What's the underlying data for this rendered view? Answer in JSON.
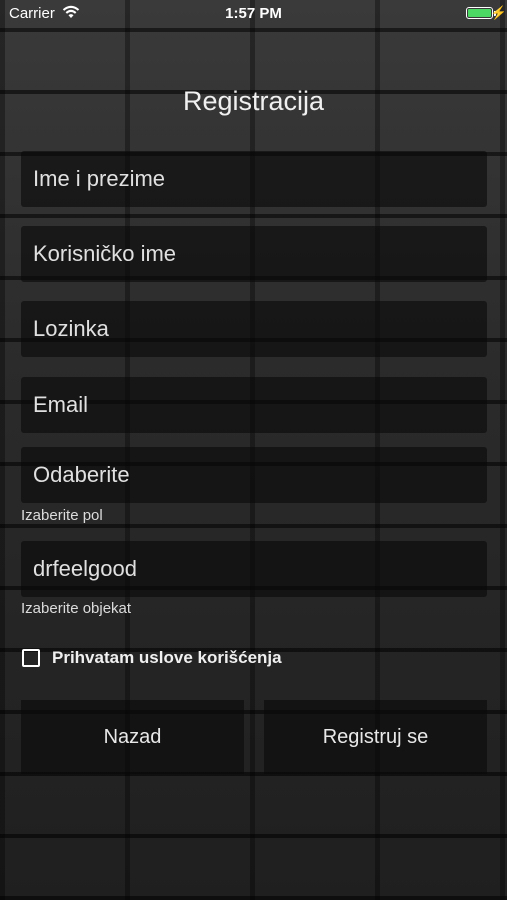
{
  "status_bar": {
    "carrier": "Carrier",
    "time": "1:57 PM",
    "battery_color": "#4cd964"
  },
  "screen": {
    "title": "Registracija"
  },
  "form": {
    "full_name_placeholder": "Ime i prezime",
    "username_placeholder": "Korisničko ime",
    "password_placeholder": "Lozinka",
    "email_placeholder": "Email",
    "gender_value": "Odaberite",
    "gender_hint": "Izaberite pol",
    "object_value": "drfeelgood",
    "object_hint": "Izaberite objekat",
    "terms_label": "Prihvatam uslove korišćenja",
    "terms_checked": false
  },
  "buttons": {
    "back_label": "Nazad",
    "register_label": "Registruj se"
  }
}
